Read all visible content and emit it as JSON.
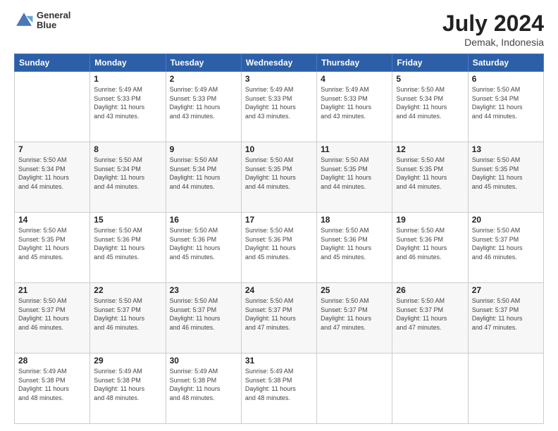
{
  "header": {
    "logo_line1": "General",
    "logo_line2": "Blue",
    "title": "July 2024",
    "subtitle": "Demak, Indonesia"
  },
  "columns": [
    "Sunday",
    "Monday",
    "Tuesday",
    "Wednesday",
    "Thursday",
    "Friday",
    "Saturday"
  ],
  "weeks": [
    [
      {
        "day": "",
        "info": ""
      },
      {
        "day": "1",
        "info": "Sunrise: 5:49 AM\nSunset: 5:33 PM\nDaylight: 11 hours\nand 43 minutes."
      },
      {
        "day": "2",
        "info": "Sunrise: 5:49 AM\nSunset: 5:33 PM\nDaylight: 11 hours\nand 43 minutes."
      },
      {
        "day": "3",
        "info": "Sunrise: 5:49 AM\nSunset: 5:33 PM\nDaylight: 11 hours\nand 43 minutes."
      },
      {
        "day": "4",
        "info": "Sunrise: 5:49 AM\nSunset: 5:33 PM\nDaylight: 11 hours\nand 43 minutes."
      },
      {
        "day": "5",
        "info": "Sunrise: 5:50 AM\nSunset: 5:34 PM\nDaylight: 11 hours\nand 44 minutes."
      },
      {
        "day": "6",
        "info": "Sunrise: 5:50 AM\nSunset: 5:34 PM\nDaylight: 11 hours\nand 44 minutes."
      }
    ],
    [
      {
        "day": "7",
        "info": "Sunrise: 5:50 AM\nSunset: 5:34 PM\nDaylight: 11 hours\nand 44 minutes."
      },
      {
        "day": "8",
        "info": "Sunrise: 5:50 AM\nSunset: 5:34 PM\nDaylight: 11 hours\nand 44 minutes."
      },
      {
        "day": "9",
        "info": "Sunrise: 5:50 AM\nSunset: 5:34 PM\nDaylight: 11 hours\nand 44 minutes."
      },
      {
        "day": "10",
        "info": "Sunrise: 5:50 AM\nSunset: 5:35 PM\nDaylight: 11 hours\nand 44 minutes."
      },
      {
        "day": "11",
        "info": "Sunrise: 5:50 AM\nSunset: 5:35 PM\nDaylight: 11 hours\nand 44 minutes."
      },
      {
        "day": "12",
        "info": "Sunrise: 5:50 AM\nSunset: 5:35 PM\nDaylight: 11 hours\nand 44 minutes."
      },
      {
        "day": "13",
        "info": "Sunrise: 5:50 AM\nSunset: 5:35 PM\nDaylight: 11 hours\nand 45 minutes."
      }
    ],
    [
      {
        "day": "14",
        "info": "Sunrise: 5:50 AM\nSunset: 5:35 PM\nDaylight: 11 hours\nand 45 minutes."
      },
      {
        "day": "15",
        "info": "Sunrise: 5:50 AM\nSunset: 5:36 PM\nDaylight: 11 hours\nand 45 minutes."
      },
      {
        "day": "16",
        "info": "Sunrise: 5:50 AM\nSunset: 5:36 PM\nDaylight: 11 hours\nand 45 minutes."
      },
      {
        "day": "17",
        "info": "Sunrise: 5:50 AM\nSunset: 5:36 PM\nDaylight: 11 hours\nand 45 minutes."
      },
      {
        "day": "18",
        "info": "Sunrise: 5:50 AM\nSunset: 5:36 PM\nDaylight: 11 hours\nand 45 minutes."
      },
      {
        "day": "19",
        "info": "Sunrise: 5:50 AM\nSunset: 5:36 PM\nDaylight: 11 hours\nand 46 minutes."
      },
      {
        "day": "20",
        "info": "Sunrise: 5:50 AM\nSunset: 5:37 PM\nDaylight: 11 hours\nand 46 minutes."
      }
    ],
    [
      {
        "day": "21",
        "info": "Sunrise: 5:50 AM\nSunset: 5:37 PM\nDaylight: 11 hours\nand 46 minutes."
      },
      {
        "day": "22",
        "info": "Sunrise: 5:50 AM\nSunset: 5:37 PM\nDaylight: 11 hours\nand 46 minutes."
      },
      {
        "day": "23",
        "info": "Sunrise: 5:50 AM\nSunset: 5:37 PM\nDaylight: 11 hours\nand 46 minutes."
      },
      {
        "day": "24",
        "info": "Sunrise: 5:50 AM\nSunset: 5:37 PM\nDaylight: 11 hours\nand 47 minutes."
      },
      {
        "day": "25",
        "info": "Sunrise: 5:50 AM\nSunset: 5:37 PM\nDaylight: 11 hours\nand 47 minutes."
      },
      {
        "day": "26",
        "info": "Sunrise: 5:50 AM\nSunset: 5:37 PM\nDaylight: 11 hours\nand 47 minutes."
      },
      {
        "day": "27",
        "info": "Sunrise: 5:50 AM\nSunset: 5:37 PM\nDaylight: 11 hours\nand 47 minutes."
      }
    ],
    [
      {
        "day": "28",
        "info": "Sunrise: 5:49 AM\nSunset: 5:38 PM\nDaylight: 11 hours\nand 48 minutes."
      },
      {
        "day": "29",
        "info": "Sunrise: 5:49 AM\nSunset: 5:38 PM\nDaylight: 11 hours\nand 48 minutes."
      },
      {
        "day": "30",
        "info": "Sunrise: 5:49 AM\nSunset: 5:38 PM\nDaylight: 11 hours\nand 48 minutes."
      },
      {
        "day": "31",
        "info": "Sunrise: 5:49 AM\nSunset: 5:38 PM\nDaylight: 11 hours\nand 48 minutes."
      },
      {
        "day": "",
        "info": ""
      },
      {
        "day": "",
        "info": ""
      },
      {
        "day": "",
        "info": ""
      }
    ]
  ]
}
